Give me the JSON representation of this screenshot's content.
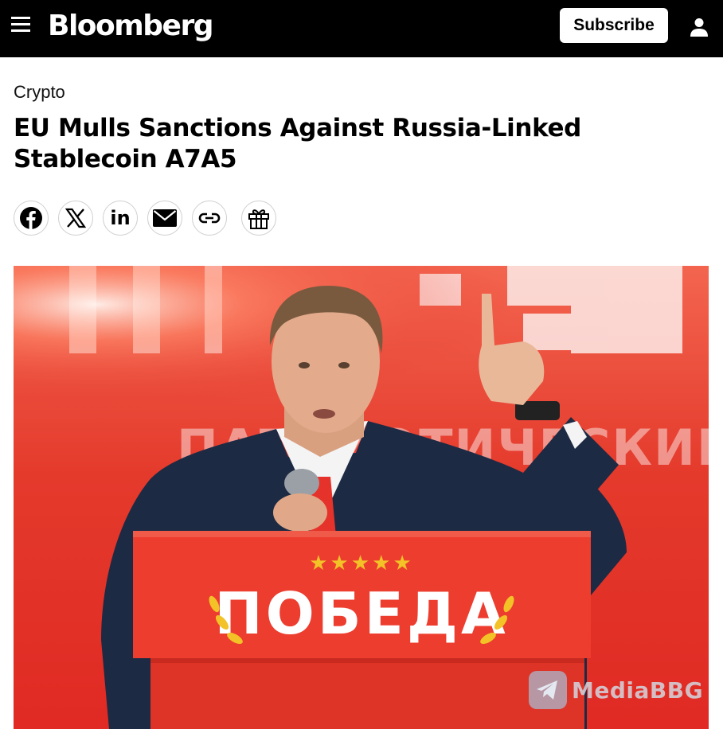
{
  "header": {
    "brand": "Bloomberg",
    "subscribe_label": "Subscribe",
    "menu_icon": "hamburger-menu-icon",
    "account_icon": "user-icon",
    "background_color": "#000000"
  },
  "article": {
    "kicker": "Crypto",
    "headline": "EU Mulls Sanctions Against Russia-Linked Stablecoin A7A5"
  },
  "share_buttons": [
    {
      "name": "facebook-icon"
    },
    {
      "name": "x-icon"
    },
    {
      "name": "linkedin-icon",
      "text": "in"
    },
    {
      "name": "email-icon"
    },
    {
      "name": "link-icon"
    },
    {
      "name": "gift-icon"
    }
  ],
  "hero_image": {
    "podium_text": "ПОБЕДА",
    "backdrop_text": "ПАТРИОТИЧЕСКИЙ",
    "stars": "★★★★★",
    "backdrop_color": "#e02a23"
  },
  "watermark": {
    "text": "MediaBBG",
    "icon": "telegram-icon"
  }
}
